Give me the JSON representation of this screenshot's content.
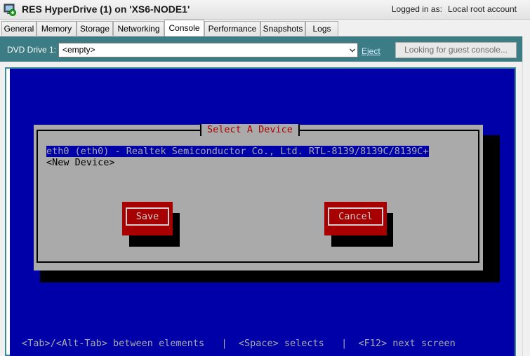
{
  "window": {
    "title": "RES HyperDrive (1) on 'XS6-NODE1'",
    "login_label": "Logged in as:",
    "login_user": "Local root account"
  },
  "tabs": [
    {
      "label": "General",
      "active": false
    },
    {
      "label": "Memory",
      "active": false
    },
    {
      "label": "Storage",
      "active": false
    },
    {
      "label": "Networking",
      "active": false
    },
    {
      "label": "Console",
      "active": true
    },
    {
      "label": "Performance",
      "active": false
    },
    {
      "label": "Snapshots",
      "active": false
    },
    {
      "label": "Logs",
      "active": false
    }
  ],
  "toolbar": {
    "dvd_label": "DVD Drive 1:",
    "dvd_value": "<empty>",
    "eject_label": "Eject",
    "guest_console_label": "Looking for guest console..."
  },
  "console": {
    "dialog_title": "Select A Device",
    "devices": [
      {
        "label": "eth0 (eth0) - Realtek Semiconductor Co., Ltd. RTL-8139/8139C/8139C+",
        "selected": true
      },
      {
        "label": "<New Device>",
        "selected": false
      }
    ],
    "save_label": "Save",
    "cancel_label": "Cancel",
    "status_line": "<Tab>/<Alt-Tab> between elements   |  <Space> selects   |  <F12> next screen"
  },
  "colors": {
    "console_bg": "#0000a8",
    "dialog_bg": "#aaaaaa",
    "accent_red": "#a80000",
    "toolbar_teal": "#3c7c84"
  }
}
